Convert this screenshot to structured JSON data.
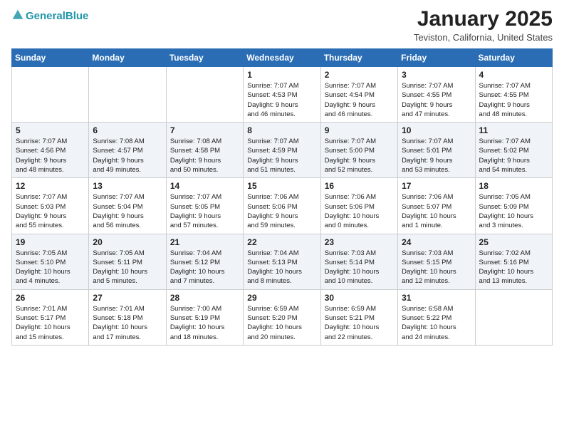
{
  "header": {
    "logo_line1": "General",
    "logo_line2": "Blue",
    "title": "January 2025",
    "subtitle": "Teviston, California, United States"
  },
  "weekdays": [
    "Sunday",
    "Monday",
    "Tuesday",
    "Wednesday",
    "Thursday",
    "Friday",
    "Saturday"
  ],
  "weeks": [
    [
      {
        "day": "",
        "info": ""
      },
      {
        "day": "",
        "info": ""
      },
      {
        "day": "",
        "info": ""
      },
      {
        "day": "1",
        "info": "Sunrise: 7:07 AM\nSunset: 4:53 PM\nDaylight: 9 hours\nand 46 minutes."
      },
      {
        "day": "2",
        "info": "Sunrise: 7:07 AM\nSunset: 4:54 PM\nDaylight: 9 hours\nand 46 minutes."
      },
      {
        "day": "3",
        "info": "Sunrise: 7:07 AM\nSunset: 4:55 PM\nDaylight: 9 hours\nand 47 minutes."
      },
      {
        "day": "4",
        "info": "Sunrise: 7:07 AM\nSunset: 4:55 PM\nDaylight: 9 hours\nand 48 minutes."
      }
    ],
    [
      {
        "day": "5",
        "info": "Sunrise: 7:07 AM\nSunset: 4:56 PM\nDaylight: 9 hours\nand 48 minutes."
      },
      {
        "day": "6",
        "info": "Sunrise: 7:08 AM\nSunset: 4:57 PM\nDaylight: 9 hours\nand 49 minutes."
      },
      {
        "day": "7",
        "info": "Sunrise: 7:08 AM\nSunset: 4:58 PM\nDaylight: 9 hours\nand 50 minutes."
      },
      {
        "day": "8",
        "info": "Sunrise: 7:07 AM\nSunset: 4:59 PM\nDaylight: 9 hours\nand 51 minutes."
      },
      {
        "day": "9",
        "info": "Sunrise: 7:07 AM\nSunset: 5:00 PM\nDaylight: 9 hours\nand 52 minutes."
      },
      {
        "day": "10",
        "info": "Sunrise: 7:07 AM\nSunset: 5:01 PM\nDaylight: 9 hours\nand 53 minutes."
      },
      {
        "day": "11",
        "info": "Sunrise: 7:07 AM\nSunset: 5:02 PM\nDaylight: 9 hours\nand 54 minutes."
      }
    ],
    [
      {
        "day": "12",
        "info": "Sunrise: 7:07 AM\nSunset: 5:03 PM\nDaylight: 9 hours\nand 55 minutes."
      },
      {
        "day": "13",
        "info": "Sunrise: 7:07 AM\nSunset: 5:04 PM\nDaylight: 9 hours\nand 56 minutes."
      },
      {
        "day": "14",
        "info": "Sunrise: 7:07 AM\nSunset: 5:05 PM\nDaylight: 9 hours\nand 57 minutes."
      },
      {
        "day": "15",
        "info": "Sunrise: 7:06 AM\nSunset: 5:06 PM\nDaylight: 9 hours\nand 59 minutes."
      },
      {
        "day": "16",
        "info": "Sunrise: 7:06 AM\nSunset: 5:06 PM\nDaylight: 10 hours\nand 0 minutes."
      },
      {
        "day": "17",
        "info": "Sunrise: 7:06 AM\nSunset: 5:07 PM\nDaylight: 10 hours\nand 1 minute."
      },
      {
        "day": "18",
        "info": "Sunrise: 7:05 AM\nSunset: 5:09 PM\nDaylight: 10 hours\nand 3 minutes."
      }
    ],
    [
      {
        "day": "19",
        "info": "Sunrise: 7:05 AM\nSunset: 5:10 PM\nDaylight: 10 hours\nand 4 minutes."
      },
      {
        "day": "20",
        "info": "Sunrise: 7:05 AM\nSunset: 5:11 PM\nDaylight: 10 hours\nand 5 minutes."
      },
      {
        "day": "21",
        "info": "Sunrise: 7:04 AM\nSunset: 5:12 PM\nDaylight: 10 hours\nand 7 minutes."
      },
      {
        "day": "22",
        "info": "Sunrise: 7:04 AM\nSunset: 5:13 PM\nDaylight: 10 hours\nand 8 minutes."
      },
      {
        "day": "23",
        "info": "Sunrise: 7:03 AM\nSunset: 5:14 PM\nDaylight: 10 hours\nand 10 minutes."
      },
      {
        "day": "24",
        "info": "Sunrise: 7:03 AM\nSunset: 5:15 PM\nDaylight: 10 hours\nand 12 minutes."
      },
      {
        "day": "25",
        "info": "Sunrise: 7:02 AM\nSunset: 5:16 PM\nDaylight: 10 hours\nand 13 minutes."
      }
    ],
    [
      {
        "day": "26",
        "info": "Sunrise: 7:01 AM\nSunset: 5:17 PM\nDaylight: 10 hours\nand 15 minutes."
      },
      {
        "day": "27",
        "info": "Sunrise: 7:01 AM\nSunset: 5:18 PM\nDaylight: 10 hours\nand 17 minutes."
      },
      {
        "day": "28",
        "info": "Sunrise: 7:00 AM\nSunset: 5:19 PM\nDaylight: 10 hours\nand 18 minutes."
      },
      {
        "day": "29",
        "info": "Sunrise: 6:59 AM\nSunset: 5:20 PM\nDaylight: 10 hours\nand 20 minutes."
      },
      {
        "day": "30",
        "info": "Sunrise: 6:59 AM\nSunset: 5:21 PM\nDaylight: 10 hours\nand 22 minutes."
      },
      {
        "day": "31",
        "info": "Sunrise: 6:58 AM\nSunset: 5:22 PM\nDaylight: 10 hours\nand 24 minutes."
      },
      {
        "day": "",
        "info": ""
      }
    ]
  ]
}
